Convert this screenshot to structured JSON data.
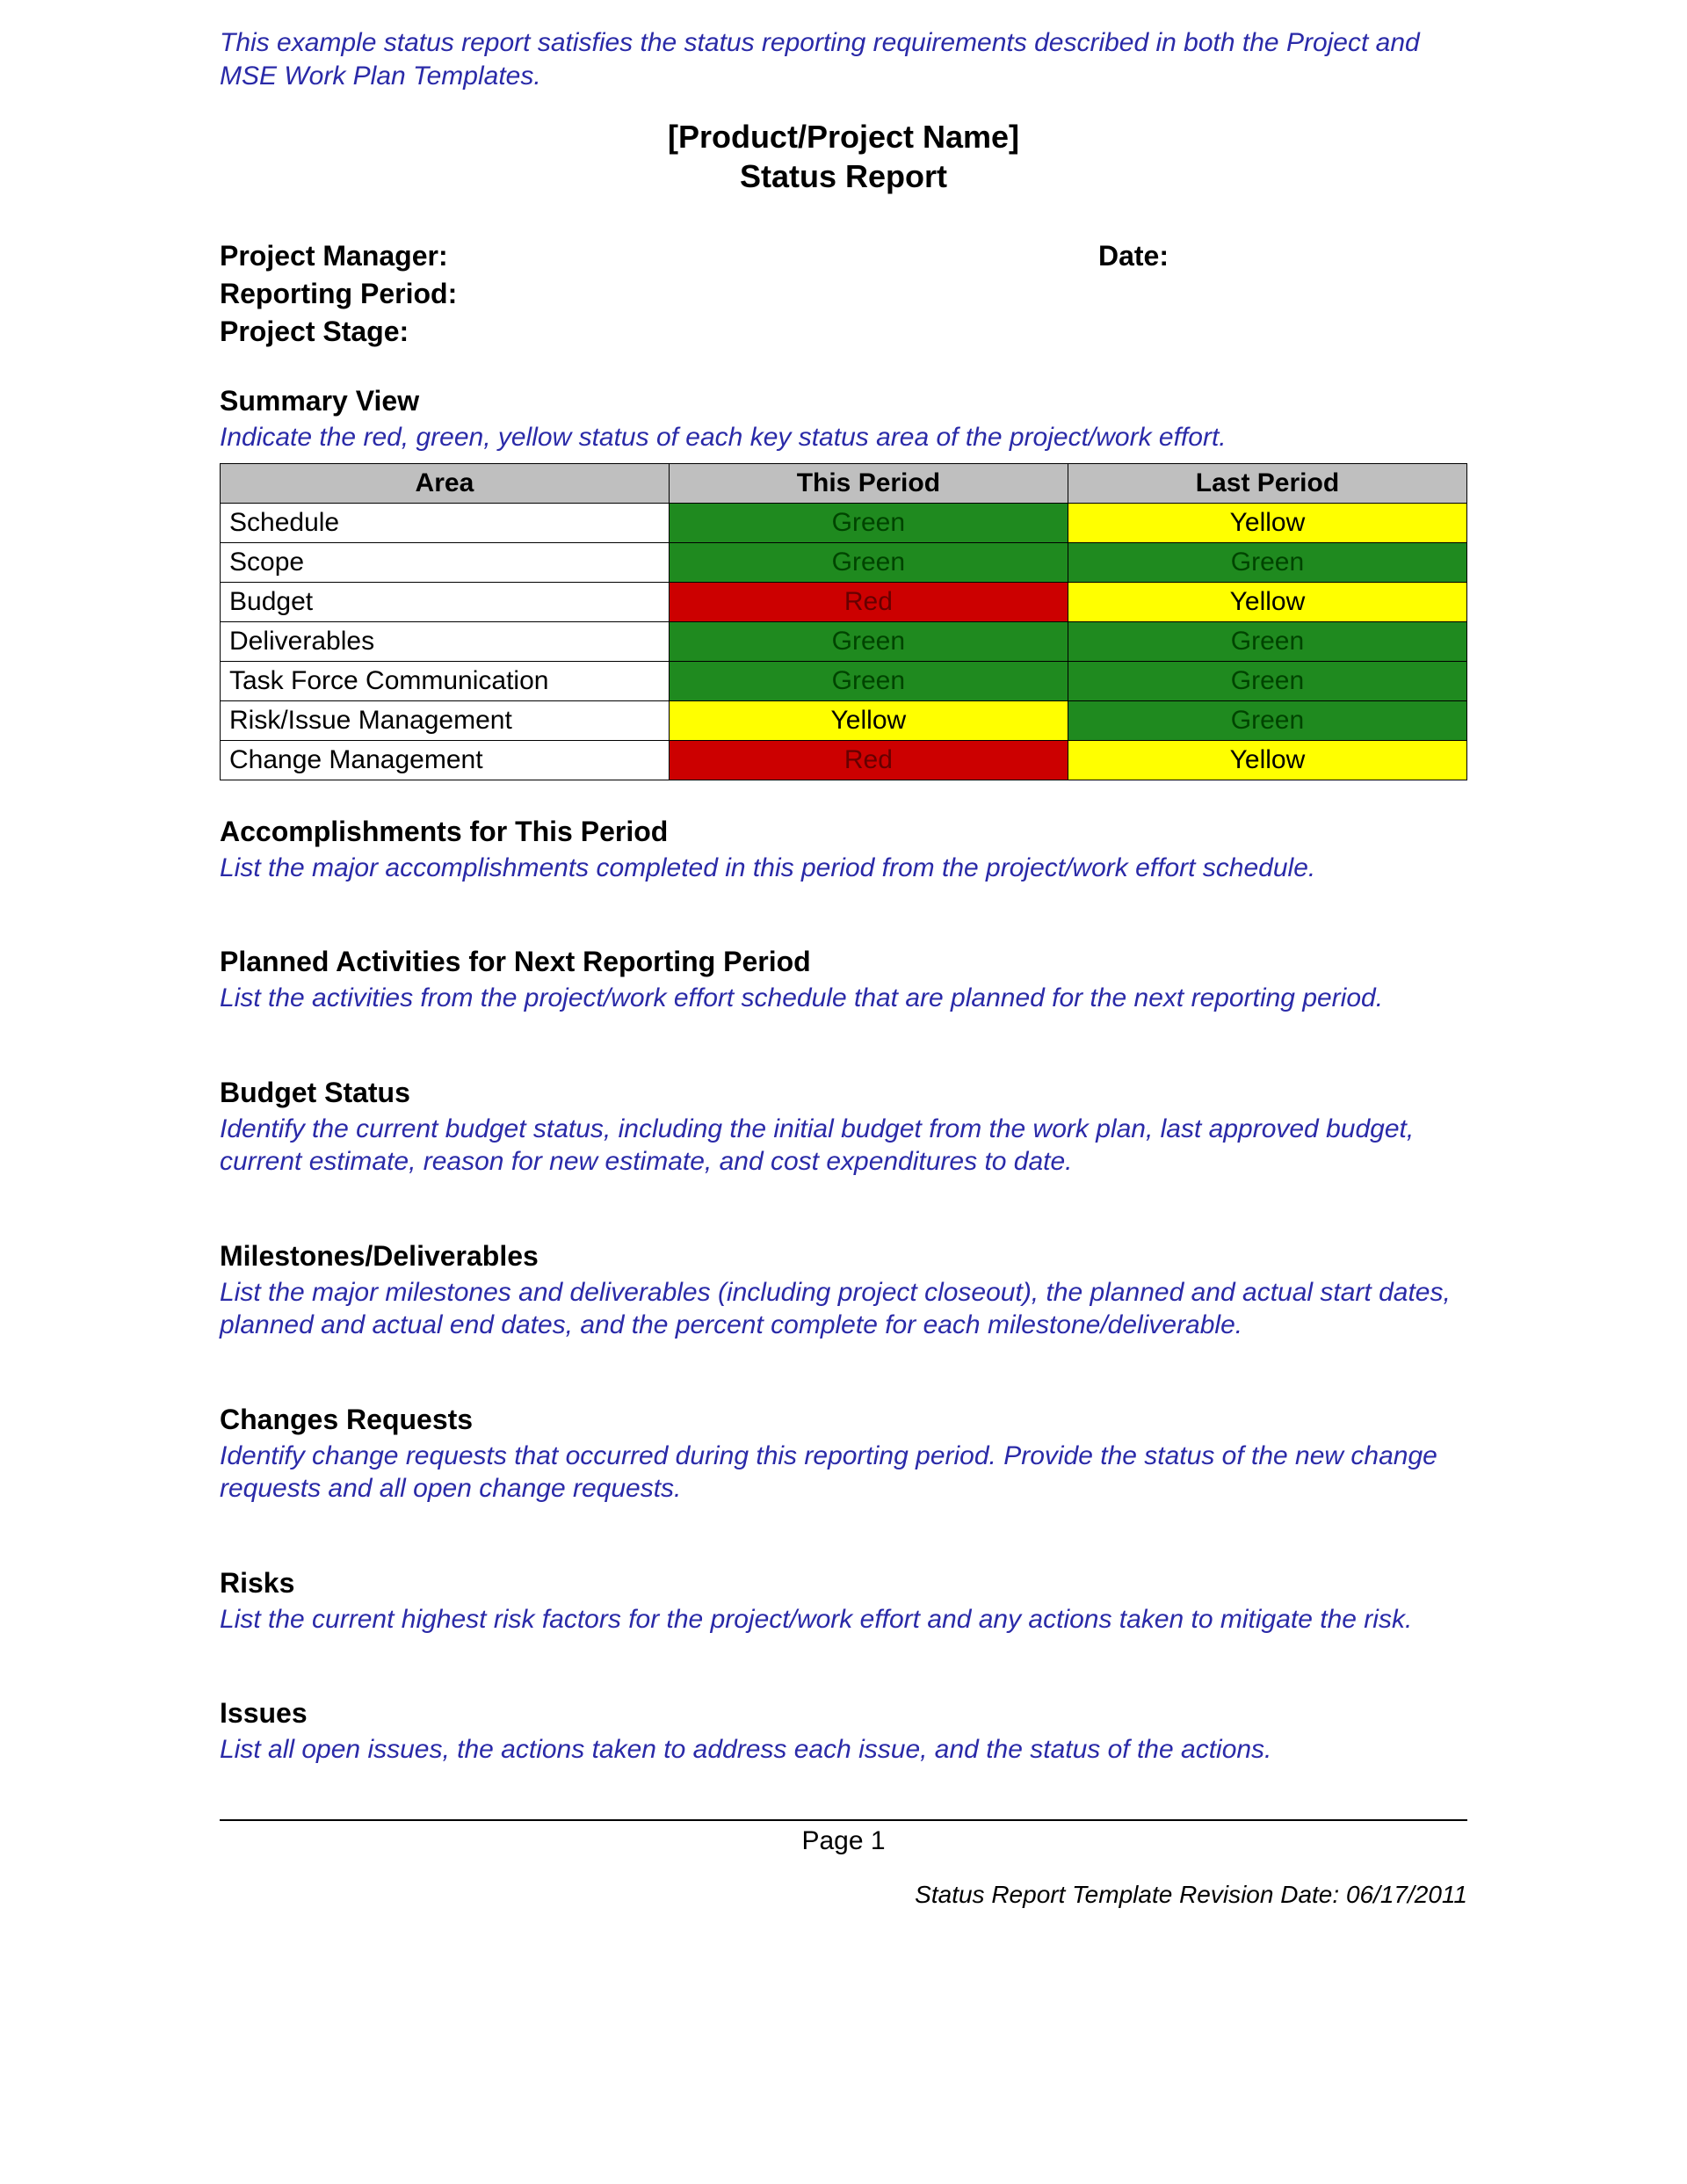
{
  "intro_note": "This example status report satisfies the status reporting requirements described in both the Project and MSE Work Plan Templates.",
  "title": {
    "line1": "[Product/Project Name]",
    "line2": "Status Report"
  },
  "meta": {
    "project_manager_label": "Project Manager:",
    "date_label": "Date:",
    "reporting_period_label": "Reporting Period:",
    "project_stage_label": "Project Stage:"
  },
  "summary_view": {
    "heading": "Summary View",
    "instructions": "Indicate the red, green, yellow status of each key status area of the project/work effort.",
    "headers": {
      "area": "Area",
      "this_period": "This Period",
      "last_period": "Last Period"
    },
    "rows": [
      {
        "area": "Schedule",
        "this_period": "Green",
        "last_period": "Yellow"
      },
      {
        "area": "Scope",
        "this_period": "Green",
        "last_period": "Green"
      },
      {
        "area": "Budget",
        "this_period": "Red",
        "last_period": "Yellow"
      },
      {
        "area": "Deliverables",
        "this_period": "Green",
        "last_period": "Green"
      },
      {
        "area": "Task Force Communication",
        "this_period": "Green",
        "last_period": "Green"
      },
      {
        "area": "Risk/Issue Management",
        "this_period": "Yellow",
        "last_period": "Green"
      },
      {
        "area": "Change Management",
        "this_period": "Red",
        "last_period": "Yellow"
      }
    ]
  },
  "sections": {
    "accomplishments": {
      "heading": "Accomplishments for This Period",
      "instructions": "List the major accomplishments completed in this period from the project/work effort schedule."
    },
    "planned": {
      "heading": "Planned Activities for Next Reporting Period",
      "instructions": "List the activities from the project/work effort schedule that are planned for the next reporting period."
    },
    "budget": {
      "heading": "Budget Status",
      "instructions": "Identify the current budget status, including the initial budget from the work plan, last approved budget, current estimate, reason for new estimate, and cost expenditures to date."
    },
    "milestones": {
      "heading": "Milestones/Deliverables",
      "instructions": "List the major milestones and deliverables (including project closeout), the planned and actual start dates, planned and actual end dates, and the percent complete for each milestone/deliverable."
    },
    "changes": {
      "heading": "Changes Requests",
      "instructions": "Identify change requests that occurred during this reporting period. Provide the status of the new change requests and all open change requests."
    },
    "risks": {
      "heading": "Risks",
      "instructions": "List the current highest risk factors for the project/work effort and any actions taken to mitigate the risk."
    },
    "issues": {
      "heading": "Issues",
      "instructions": "List all open issues, the actions taken to address each issue, and the status of the actions."
    }
  },
  "footer": {
    "page_label": "Page 1",
    "revision": "Status Report Template Revision Date: 06/17/2011"
  }
}
